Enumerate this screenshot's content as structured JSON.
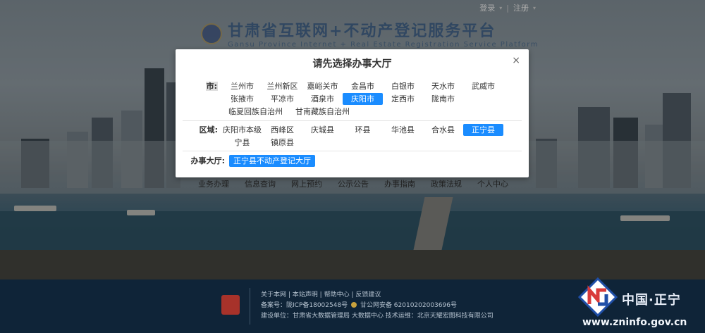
{
  "topbar": {
    "login": "登录",
    "register": "注册",
    "sep": "|"
  },
  "header": {
    "title": "甘肃省互联网+不动产登记服务平台",
    "subtitle": "Gansu Province Internet + Real Estate Registration Service Platform"
  },
  "nav": [
    "业务办理",
    "信息查询",
    "网上预约",
    "公示公告",
    "办事指南",
    "政策法规",
    "个人中心"
  ],
  "modal": {
    "title": "请先选择办事大厅",
    "close": "×",
    "city_label": "市:",
    "cities": [
      "兰州市",
      "兰州新区",
      "嘉峪关市",
      "金昌市",
      "白银市",
      "天水市",
      "武威市",
      "张掖市",
      "平凉市",
      "酒泉市",
      "庆阳市",
      "定西市",
      "陇南市",
      "临夏回族自治州",
      "甘南藏族自治州"
    ],
    "selected_city": "庆阳市",
    "district_label": "区域:",
    "districts": [
      "庆阳市本级",
      "西峰区",
      "庆城县",
      "环县",
      "华池县",
      "合水县",
      "正宁县",
      "宁县",
      "镇原县"
    ],
    "selected_district": "正宁县",
    "office_label": "办事大厅:",
    "office": "正宁县不动产登记大厅"
  },
  "footer": {
    "links": [
      "关于本网",
      "本站声明",
      "帮助中心",
      "反馈建议"
    ],
    "icp": "备案号：陇ICP备18002548号",
    "police": "甘公网安备 62010202003696号",
    "org": "建设单位：甘肃省大数据管理局 大数据中心  技术运维：北京天耀宏图科技有限公司"
  },
  "watermark": {
    "name": "中国·正宁",
    "url": "www.zninfo.gov.cn"
  },
  "colors": {
    "accent": "#1a8cff",
    "footer_bg": "#0f2438",
    "emblem": "#a7322a"
  }
}
